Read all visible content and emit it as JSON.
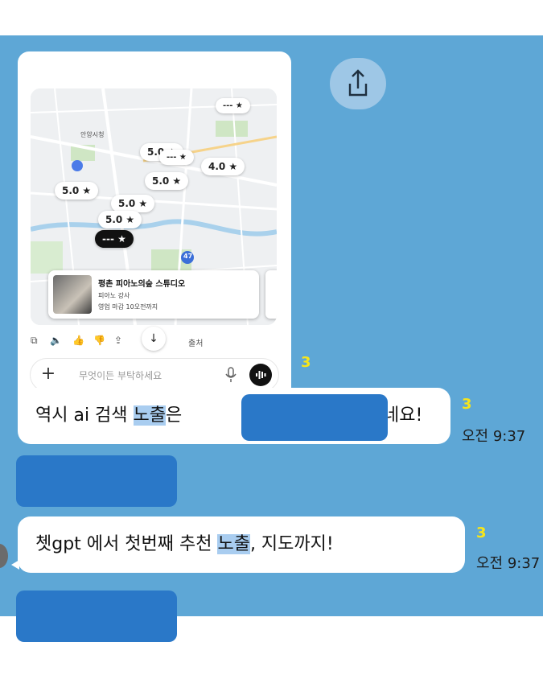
{
  "shared_screenshot": {
    "map": {
      "labels": {
        "district": "안양시청"
      },
      "rating_pills": [
        {
          "text": "--- ★"
        },
        {
          "text": "5.0 ★"
        },
        {
          "text": "--- ★"
        },
        {
          "text": "4.0 ★"
        },
        {
          "text": "5.0 ★"
        },
        {
          "text": "5.0 ★"
        },
        {
          "text": "5.0 ★"
        },
        {
          "text": "5.0 ★"
        },
        {
          "text": "--- ★"
        }
      ],
      "route_badge": "47",
      "place": {
        "name": "평촌 피아노의숲 스튜디오",
        "category": "피아노 강사",
        "hours": "영업 마감 10오전까지"
      }
    },
    "actions": {
      "source_label": "출처"
    },
    "input": {
      "placeholder": "무엇이든 부탁하세요"
    }
  },
  "messages": [
    {
      "unread": "3"
    },
    {
      "unread": "3",
      "text_before": "역시 ai 검색 ",
      "highlight": "노출",
      "text_after": "은 ",
      "text_end": "네요!",
      "time": "오전 9:37"
    },
    {
      "unread": "3",
      "text_before": "쳇gpt 에서 첫번째 추천 ",
      "highlight": "노출",
      "text_after": ", 지도까지!",
      "time": "오전 9:37"
    }
  ],
  "colors": {
    "chat_background": "#5ea7d6",
    "unread_count": "#f7e51a",
    "highlight": "#a9cdf0",
    "redaction": "#2a78c8"
  }
}
